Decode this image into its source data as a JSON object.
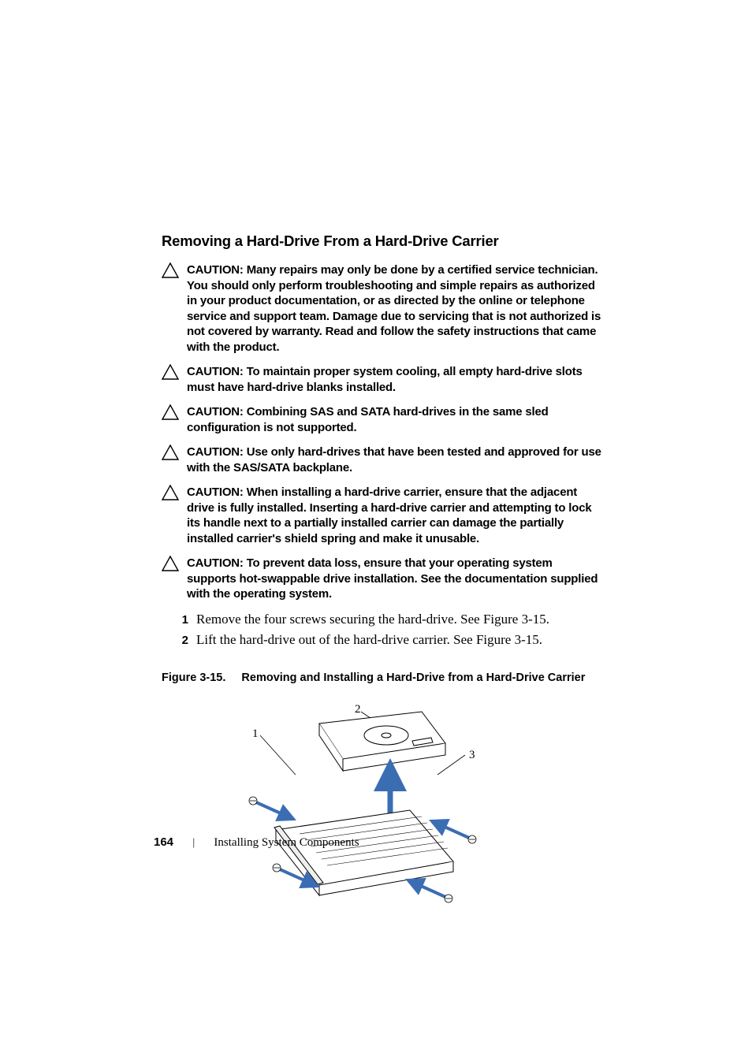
{
  "heading": "Removing a Hard-Drive From a Hard-Drive Carrier",
  "cautions": [
    {
      "label": "CAUTION:",
      "body": "Many repairs may only be done by a certified service technician. You should only perform troubleshooting and simple repairs as authorized in your product documentation, or as directed by the online or telephone service and support team. Damage due to servicing that is not authorized is not covered by warranty. Read and follow the safety instructions that came with the product."
    },
    {
      "label": "CAUTION:",
      "body": "To maintain proper system cooling, all empty hard-drive slots must have hard-drive blanks installed."
    },
    {
      "label": "CAUTION:",
      "body": "Combining SAS and SATA hard-drives in the same sled configuration is not supported."
    },
    {
      "label": "CAUTION:",
      "body": "Use only hard-drives that have been tested and approved for use with the SAS/SATA backplane."
    },
    {
      "label": "CAUTION:",
      "body": "When installing a hard-drive carrier, ensure that the adjacent drive is fully installed. Inserting a hard-drive carrier and attempting to lock its handle next to a partially installed carrier can damage the partially installed carrier's shield spring and make it unusable."
    },
    {
      "label": "CAUTION:",
      "body": "To prevent data loss, ensure that your operating system supports hot-swappable drive installation. See the documentation supplied with the operating system."
    }
  ],
  "steps": [
    {
      "num": "1",
      "text": "Remove the four screws securing the hard-drive. See Figure 3-15."
    },
    {
      "num": "2",
      "text": "Lift the hard-drive out of the hard-drive carrier. See Figure 3-15."
    }
  ],
  "figure": {
    "label": "Figure 3-15.",
    "title": "Removing and Installing a Hard-Drive from a Hard-Drive Carrier",
    "callouts": {
      "c1": "1",
      "c2": "2",
      "c3": "3"
    }
  },
  "footer": {
    "page": "164",
    "sep": "|",
    "section": "Installing System Components"
  }
}
